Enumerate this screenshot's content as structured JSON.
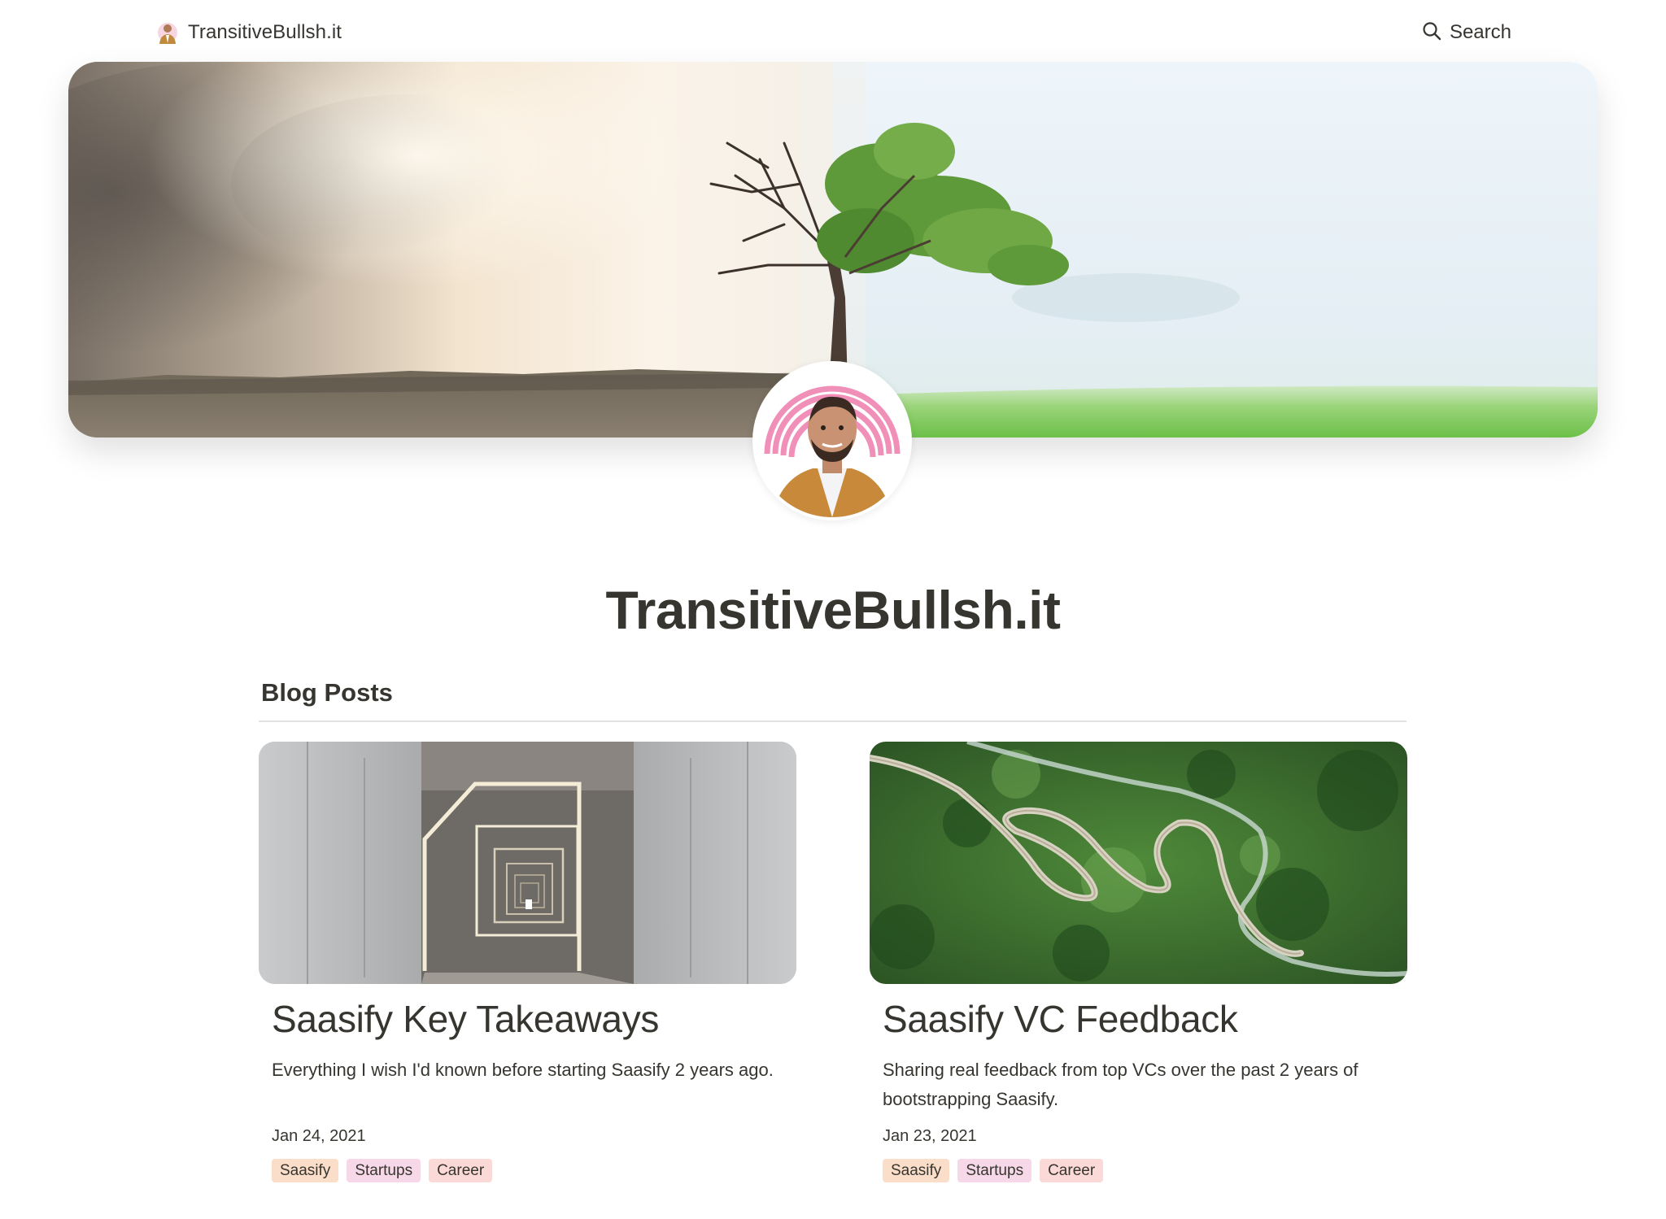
{
  "header": {
    "site_name": "TransitiveBullsh.it",
    "search_label": "Search"
  },
  "site": {
    "title": "TransitiveBullsh.it"
  },
  "blog": {
    "heading": "Blog Posts",
    "posts": [
      {
        "title": "Saasify Key Takeaways",
        "description": "Everything I wish I'd known before starting Saasify 2 years ago.",
        "date": "Jan 24, 2021",
        "tags": [
          "Saasify",
          "Startups",
          "Career"
        ]
      },
      {
        "title": "Saasify VC Feedback",
        "description": "Sharing real feedback from top VCs over the past 2 years of bootstrapping Saasify.",
        "date": "Jan 23, 2021",
        "tags": [
          "Saasify",
          "Startups",
          "Career"
        ]
      }
    ]
  },
  "icons": {
    "search": "search-icon",
    "brand": "avatar-icon"
  },
  "colors": {
    "text": "#37352f",
    "tag_saasify": "#fadec9",
    "tag_startups": "#f6d8e8",
    "tag_career": "#fbd9d6",
    "divider": "#e3e2e0"
  }
}
